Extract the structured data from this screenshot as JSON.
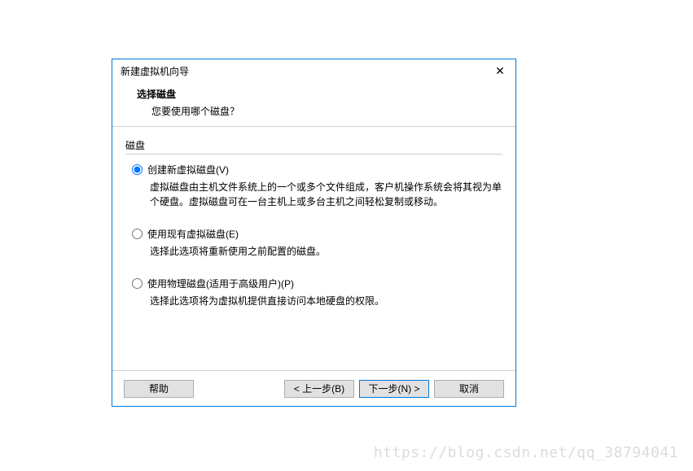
{
  "dialog": {
    "title": "新建虚拟机向导",
    "close": "✕"
  },
  "header": {
    "title": "选择磁盘",
    "subtitle": "您要使用哪个磁盘？"
  },
  "group": {
    "label": "磁盘"
  },
  "options": [
    {
      "label": "创建新虚拟磁盘(V)",
      "desc": "虚拟磁盘由主机文件系统上的一个或多个文件组成，客户机操作系统会将其视为单个硬盘。虚拟磁盘可在一台主机上或多台主机之间轻松复制或移动。",
      "checked": true
    },
    {
      "label": "使用现有虚拟磁盘(E)",
      "desc": "选择此选项将重新使用之前配置的磁盘。",
      "checked": false
    },
    {
      "label": "使用物理磁盘(适用于高级用户)(P)",
      "desc": "选择此选项将为虚拟机提供直接访问本地硬盘的权限。",
      "checked": false
    }
  ],
  "buttons": {
    "help": "帮助",
    "back": "< 上一步(B)",
    "next": "下一步(N) >",
    "cancel": "取消"
  },
  "watermark": "https://blog.csdn.net/qq_38794041"
}
